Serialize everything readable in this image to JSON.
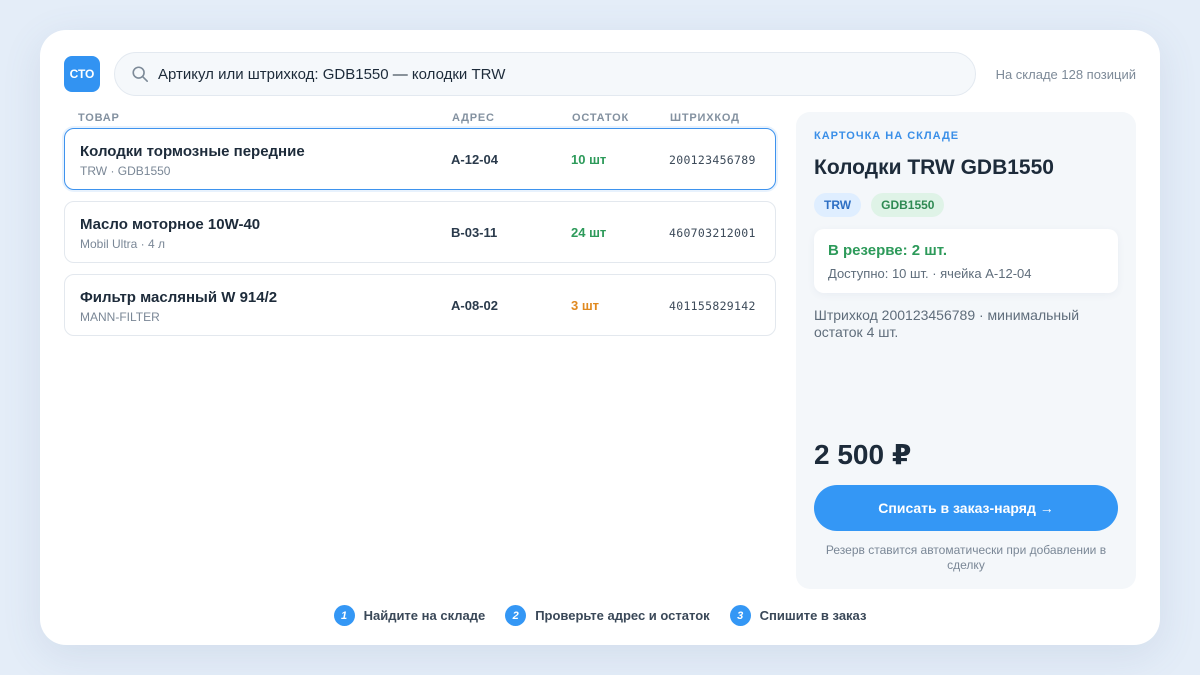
{
  "logo": "СТО",
  "search": {
    "value": "Артикул или штрихкод: GDB1550 — колодки TRW",
    "icon": "search-icon"
  },
  "stock_summary": "На складе 128 позиций",
  "table": {
    "headers": [
      "ТОВАР",
      "АДРЕС",
      "ОСТАТОК",
      "ШТРИХКОД"
    ],
    "rows": [
      {
        "name": "Колодки тормозные передние",
        "sub": "TRW · GDB1550",
        "address": "A-12-04",
        "qty": "10 шт",
        "barcode": "200123456789",
        "status": "ok",
        "selected": true
      },
      {
        "name": "Масло моторное 10W-40",
        "sub": "Mobil Ultra · 4 л",
        "address": "B-03-11",
        "qty": "24 шт",
        "barcode": "460703212001",
        "status": "ok",
        "selected": false
      },
      {
        "name": "Фильтр масляный W 914/2",
        "sub": "MANN-FILTER",
        "address": "A-08-02",
        "qty": "3 шт",
        "barcode": "401155829142",
        "status": "low",
        "selected": false
      }
    ]
  },
  "panel": {
    "eyebrow": "КАРТОЧКА НА СКЛАДЕ",
    "title": "Колодки TRW GDB1550",
    "tags": [
      "TRW",
      "GDB1550"
    ],
    "reserve_title": "В резерве: 2 шт.",
    "reserve_sub": "Доступно: 10 шт. · ячейка A-12-04",
    "info": "Штрихкод 200123456789 · минимальный остаток 4 шт.",
    "price": "2 500 ₽",
    "action": "Списать в заказ-наряд →",
    "note": "Резерв ставится автоматически при добавлении в сделку"
  },
  "steps": [
    {
      "num": "1",
      "label": "Найдите на складе"
    },
    {
      "num": "2",
      "label": "Проверьте адрес и остаток"
    },
    {
      "num": "3",
      "label": "Спишите в заказ"
    }
  ],
  "colors": {
    "accent": "#3497f5",
    "ok": "#2d9a5a",
    "low": "#e0891f"
  }
}
